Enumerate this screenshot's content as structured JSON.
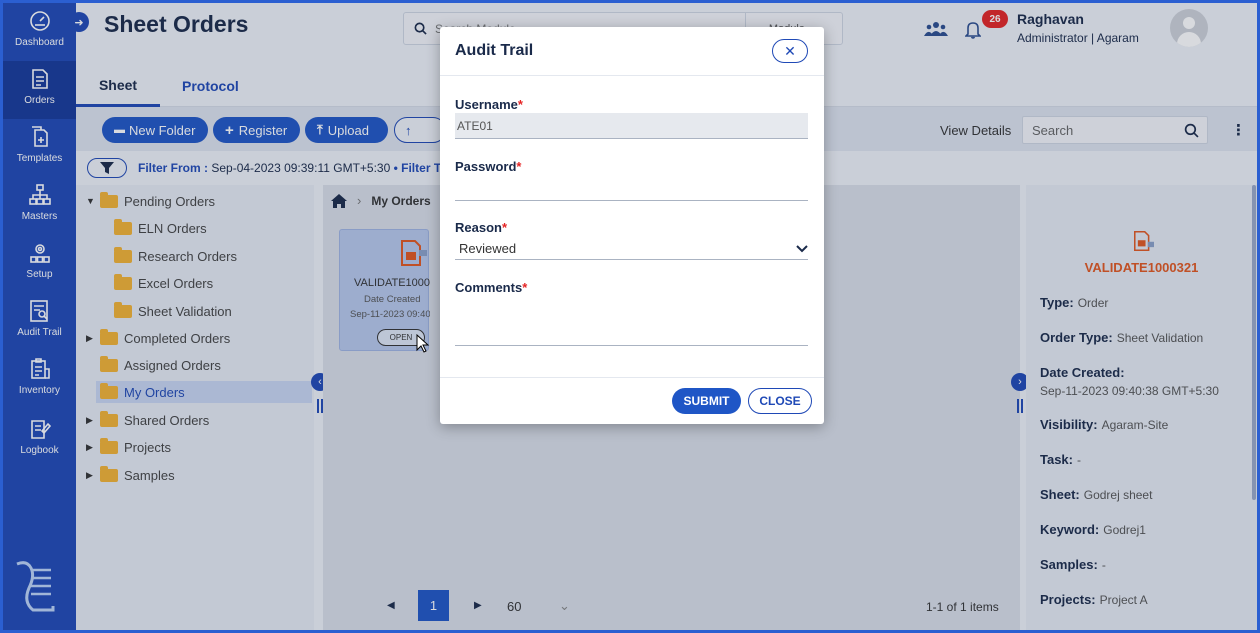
{
  "colors": {
    "accent": "#1f49b6",
    "nav_bg": "#1f49b6",
    "badge": "#e52424",
    "order_id": "#e2571f"
  },
  "nav": [
    {
      "label": "Dashboard",
      "icon": "gauge-icon"
    },
    {
      "label": "Orders",
      "icon": "orders-icon"
    },
    {
      "label": "Templates",
      "icon": "templates-icon"
    },
    {
      "label": "Masters",
      "icon": "masters-icon"
    },
    {
      "label": "Setup",
      "icon": "setup-icon"
    },
    {
      "label": "Audit Trail",
      "icon": "audit-icon"
    },
    {
      "label": "Inventory",
      "icon": "inventory-icon"
    },
    {
      "label": "Logbook",
      "icon": "logbook-icon"
    }
  ],
  "header": {
    "title": "Sheet Orders",
    "search_placeholder": "Search Module",
    "module_label": "Module",
    "notification_count": "26",
    "user_name": "Raghavan",
    "user_role": "Administrator | Agaram"
  },
  "tabs": [
    "Sheet",
    "Protocol"
  ],
  "toolbar": {
    "new_folder": "New Folder",
    "register": "Register",
    "upload": "Upload",
    "view_details": "View Details",
    "search_placeholder": "Search"
  },
  "filter": {
    "prefix": "Filter From :",
    "date": "Sep-04-2023 09:39:11 GMT+5:30",
    "suffix": "• Filter T"
  },
  "tree": [
    {
      "label": "Pending Orders"
    },
    {
      "label": "ELN Orders"
    },
    {
      "label": "Research Orders"
    },
    {
      "label": "Excel Orders"
    },
    {
      "label": "Sheet Validation"
    },
    {
      "label": "Completed Orders"
    },
    {
      "label": "Assigned Orders"
    },
    {
      "label": "My Orders"
    },
    {
      "label": "Shared Orders"
    },
    {
      "label": "Projects"
    },
    {
      "label": "Samples"
    }
  ],
  "main": {
    "breadcrumb": "My Orders",
    "card": {
      "title": "VALIDATE1000321",
      "subtitle": "Date Created",
      "date": "Sep-11-2023 09:40",
      "status": "OPEN"
    },
    "pager": {
      "page": "1",
      "page_size": "60",
      "info": "1-1 of 1 items"
    }
  },
  "details": {
    "order_id": "VALIDATE1000321",
    "rows": [
      {
        "key": "Type:",
        "value": "Order"
      },
      {
        "key": "Order Type:",
        "value": "Sheet Validation"
      },
      {
        "key": "Date Created:",
        "value": "Sep-11-2023 09:40:38 GMT+5:30"
      },
      {
        "key": "Visibility:",
        "value": "Agaram-Site"
      },
      {
        "key": "Task:",
        "value": "-"
      },
      {
        "key": "Sheet:",
        "value": "Godrej sheet"
      },
      {
        "key": "Keyword:",
        "value": "Godrej1"
      },
      {
        "key": "Samples:",
        "value": "-"
      },
      {
        "key": "Projects:",
        "value": "Project A"
      }
    ]
  },
  "dialog": {
    "title": "Audit Trail",
    "username_label": "Username",
    "username_value": "ATE01",
    "password_label": "Password",
    "reason_label": "Reason",
    "reason_value": "Reviewed",
    "comments_label": "Comments",
    "submit": "SUBMIT",
    "close": "CLOSE"
  }
}
